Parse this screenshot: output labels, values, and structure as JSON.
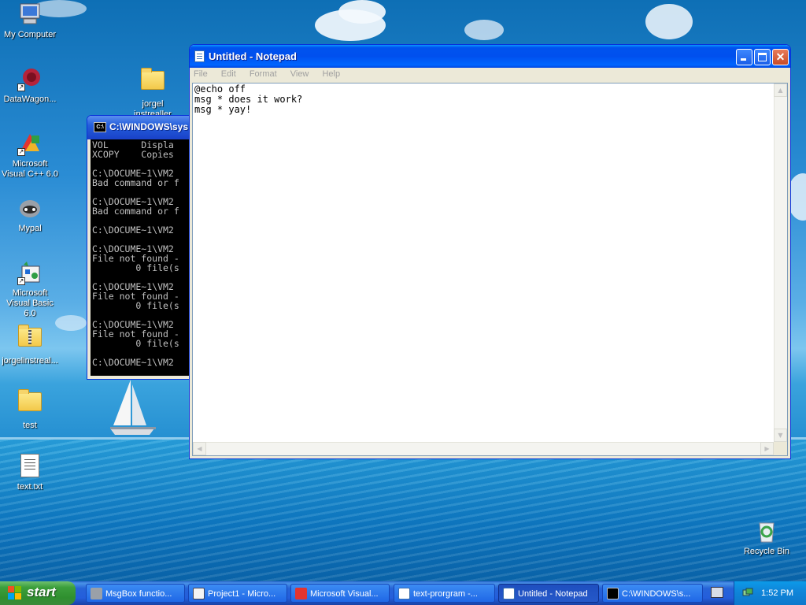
{
  "desktop": {
    "icons": [
      {
        "label": "My Computer"
      },
      {
        "label": "DataWagon..."
      },
      {
        "label": "jorgel instrealler"
      },
      {
        "label": "Microsoft Visual C++ 6.0"
      },
      {
        "label": "Mypal"
      },
      {
        "label": "Microsoft Visual Basic 6.0"
      },
      {
        "label": "jorgelinstreal..."
      },
      {
        "label": "test"
      },
      {
        "label": "text.txt"
      },
      {
        "label": "Recycle Bin"
      }
    ]
  },
  "cmd_window": {
    "title": "C:\\WINDOWS\\sys",
    "icon_text": "C:\\",
    "lines": "VOL      Displa\nXCOPY    Copies\n\nC:\\DOCUME~1\\VM2\nBad command or f\n\nC:\\DOCUME~1\\VM2\nBad command or f\n\nC:\\DOCUME~1\\VM2\n\nC:\\DOCUME~1\\VM2\nFile not found -\n        0 file(s\n\nC:\\DOCUME~1\\VM2\nFile not found -\n        0 file(s\n\nC:\\DOCUME~1\\VM2\nFile not found -\n        0 file(s\n\nC:\\DOCUME~1\\VM2"
  },
  "notepad": {
    "title": "Untitled - Notepad",
    "menu": [
      "File",
      "Edit",
      "Format",
      "View",
      "Help"
    ],
    "content": "@echo off\nmsg * does it work?\nmsg * yay!",
    "close_glyph": "✕"
  },
  "taskbar": {
    "start_label": "start",
    "buttons": [
      {
        "label": "MsgBox functio..."
      },
      {
        "label": "Project1 - Micro..."
      },
      {
        "label": "Microsoft Visual..."
      },
      {
        "label": "text-prorgram -..."
      },
      {
        "label": "Untitled - Notepad"
      },
      {
        "label": "C:\\WINDOWS\\s..."
      }
    ],
    "clock": "1:52 PM"
  },
  "colors": {
    "xp_blue": "#0053ee",
    "start_green": "#3c9f3c",
    "tray_blue": "#0f86da"
  }
}
